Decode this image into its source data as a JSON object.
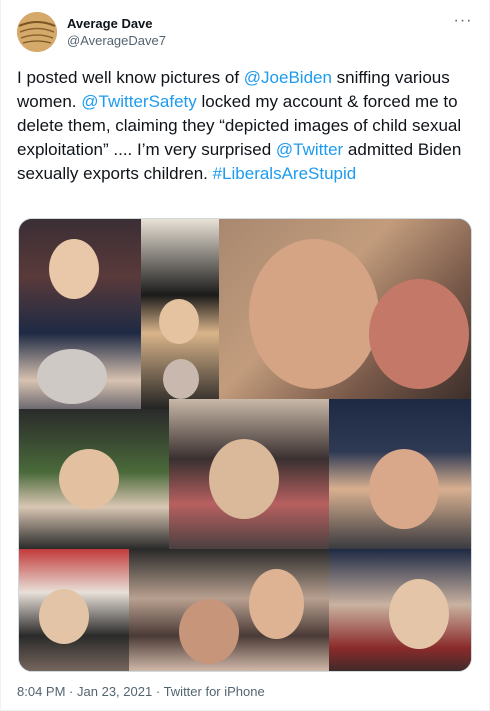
{
  "user": {
    "display_name": "Average Dave",
    "handle": "@AverageDave7"
  },
  "tweet": {
    "parts": [
      {
        "text": "I posted well know pictures of ",
        "link": false
      },
      {
        "text": "@JoeBiden",
        "link": true
      },
      {
        "text": " sniffing various women. ",
        "link": false
      },
      {
        "text": "@TwitterSafety",
        "link": true
      },
      {
        "text": " locked my account & forced me to delete them, claiming they “depicted images of child sexual exploitation” .... I’m very surprised ",
        "link": false
      },
      {
        "text": "@Twitter",
        "link": true
      },
      {
        "text": " admitted Biden sexually exports children. ",
        "link": false
      },
      {
        "text": "#LiberalsAreStupid",
        "link": true
      }
    ]
  },
  "media": {
    "description": "photo collage"
  },
  "meta": {
    "time": "8:04 PM",
    "separator": "·",
    "date": "Jan 23, 2021",
    "source": "Twitter for iPhone"
  },
  "colors": {
    "link": "#1d9bf0",
    "secondary_text": "#536471",
    "primary_text": "#0f1419"
  },
  "icons": {
    "more": "more-dots-icon"
  }
}
